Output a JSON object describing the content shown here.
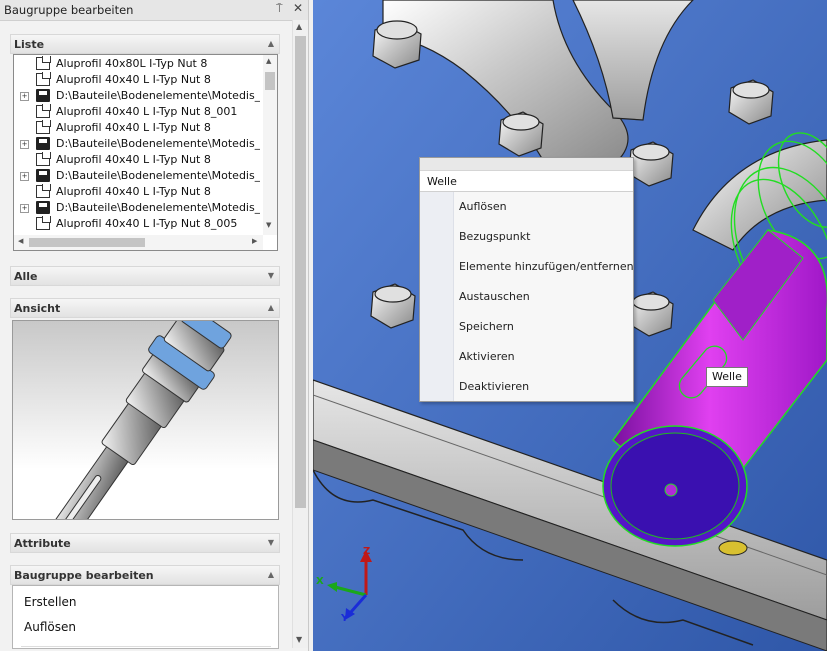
{
  "panel": {
    "title": "Baugruppe bearbeiten",
    "pin_icon": "pin-icon",
    "close_icon": "close-icon"
  },
  "sections": {
    "liste": "Liste",
    "alle": "Alle",
    "ansicht": "Ansicht",
    "attribute": "Attribute",
    "baugruppe": "Baugruppe bearbeiten"
  },
  "list": {
    "rows": [
      {
        "type": "component",
        "expand": false,
        "label": "Aluprofil 40x80L I-Typ Nut 8"
      },
      {
        "type": "component",
        "expand": false,
        "label": "Aluprofil 40x40 L I-Typ Nut 8"
      },
      {
        "type": "file",
        "expand": true,
        "label": "D:\\Bauteile\\Bodenelemente\\Motedis_Gelenk"
      },
      {
        "type": "component",
        "expand": false,
        "label": "Aluprofil 40x40 L I-Typ Nut 8_001"
      },
      {
        "type": "component",
        "expand": false,
        "label": "Aluprofil 40x40 L I-Typ Nut 8"
      },
      {
        "type": "file",
        "expand": true,
        "label": "D:\\Bauteile\\Bodenelemente\\Motedis_Gelenk"
      },
      {
        "type": "component",
        "expand": false,
        "label": "Aluprofil 40x40 L I-Typ Nut 8"
      },
      {
        "type": "file",
        "expand": true,
        "label": "D:\\Bauteile\\Bodenelemente\\Motedis_Gelenk"
      },
      {
        "type": "component",
        "expand": false,
        "label": "Aluprofil 40x40 L I-Typ Nut 8"
      },
      {
        "type": "file",
        "expand": true,
        "label": "D:\\Bauteile\\Bodenelemente\\Motedis_Gelenk"
      },
      {
        "type": "component",
        "expand": false,
        "label": "Aluprofil 40x40 L I-Typ Nut 8_005"
      }
    ]
  },
  "commands": {
    "erstellen": "Erstellen",
    "aufloesen": "Auflösen"
  },
  "context_menu": {
    "header": "Welle",
    "items": [
      "Auflösen",
      "Bezugspunkt",
      "Elemente hinzufügen/entfernen",
      "Austauschen",
      "Speichern",
      "Aktivieren",
      "Deaktivieren"
    ]
  },
  "tooltip": "Welle",
  "triad": {
    "x": "X",
    "y": "Y",
    "z": "Z"
  },
  "colors": {
    "background": "#3b63b8",
    "selection": "#22dd22",
    "part": "#c020e0",
    "axis_x": "#1aa81a",
    "axis_y": "#1a2cd8",
    "axis_z": "#c01818"
  }
}
